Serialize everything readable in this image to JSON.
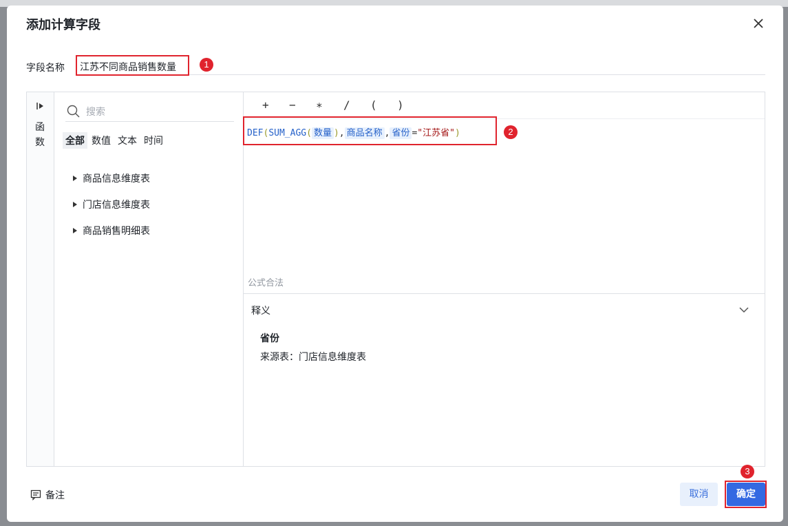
{
  "dialog": {
    "title": "添加计算字段",
    "field_label": "字段名称",
    "field_value": "江苏不同商品销售数量"
  },
  "side_tab": {
    "label_1": "函",
    "label_2": "数"
  },
  "search": {
    "placeholder": "搜索"
  },
  "filters": [
    "全部",
    "数值",
    "文本",
    "时间"
  ],
  "tables": [
    "商品信息维度表",
    "门店信息维度表",
    "商品销售明细表"
  ],
  "operators": [
    "+",
    "−",
    "∗",
    "/",
    "(",
    ")"
  ],
  "formula": {
    "fn": "DEF",
    "open": "(",
    "fn2": "SUM_AGG",
    "open2": "(",
    "field1": "数量",
    "close2": ")",
    "comma1": ",",
    "field2": "商品名称",
    "comma2": ",",
    "field3": "省份",
    "eq": "=",
    "str": "\"江苏省\"",
    "close": ")"
  },
  "status_text": "公式合法",
  "explain": {
    "header": "释义",
    "field_name": "省份",
    "source": "来源表：门店信息维度表"
  },
  "note_label": "备注",
  "buttons": {
    "cancel": "取消",
    "ok": "确定"
  },
  "badges": [
    "1",
    "2",
    "3"
  ],
  "colors": {
    "accent": "#3469e2",
    "highlight": "#e0232d"
  }
}
